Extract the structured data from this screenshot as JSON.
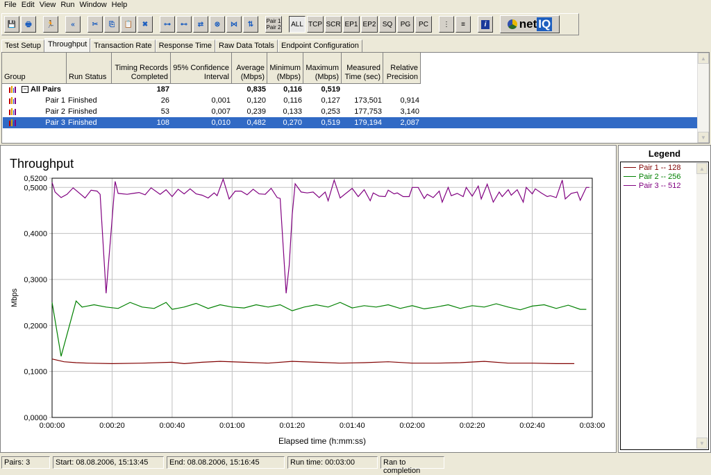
{
  "menu": [
    "File",
    "Edit",
    "View",
    "Run",
    "Window",
    "Help"
  ],
  "toolbar": {
    "buttons": [
      {
        "name": "save-icon",
        "label": "💾"
      },
      {
        "name": "print-icon",
        "label": "🖶"
      },
      {
        "name": "run-icon",
        "label": "🏃"
      },
      {
        "name": "stop-icon",
        "label": "«"
      },
      {
        "name": "cut-icon",
        "label": "✂"
      },
      {
        "name": "copy-icon",
        "label": "⎘"
      },
      {
        "name": "paste-icon",
        "label": "📋"
      },
      {
        "name": "delete-icon",
        "label": "✖"
      },
      {
        "name": "add-pair-icon",
        "label": "⊶"
      },
      {
        "name": "add-multicast-icon",
        "label": "⊷"
      },
      {
        "name": "edit-pair-icon",
        "label": "⇄"
      },
      {
        "name": "delete-pair-icon",
        "label": "⊗"
      },
      {
        "name": "network-icon",
        "label": "⋈"
      },
      {
        "name": "swap-icon",
        "label": "⇅"
      }
    ],
    "pair_toggle": [
      "Pair 1",
      "Pair 2"
    ],
    "filters": [
      "ALL",
      "TCP",
      "SCR",
      "EP1",
      "EP2",
      "SQ",
      "PG",
      "PC"
    ],
    "active_filter": "ALL",
    "logo": "netIQ"
  },
  "tabs": [
    "Test Setup",
    "Throughput",
    "Transaction Rate",
    "Response Time",
    "Raw Data Totals",
    "Endpoint Configuration"
  ],
  "active_tab": "Throughput",
  "table": {
    "columns": [
      [
        "Group",
        ""
      ],
      [
        "Run Status",
        ""
      ],
      [
        "Timing Records",
        "Completed"
      ],
      [
        "95% Confidence",
        "Interval"
      ],
      [
        "Average",
        "(Mbps)"
      ],
      [
        "Minimum",
        "(Mbps)"
      ],
      [
        "Maximum",
        "(Mbps)"
      ],
      [
        "Measured",
        "Time (sec)"
      ],
      [
        "Relative",
        "Precision"
      ]
    ],
    "group_row": {
      "label": "All Pairs",
      "records": "187",
      "average": "0,835",
      "minimum": "0,116",
      "maximum": "0,519"
    },
    "rows": [
      {
        "group": "Pair 1",
        "status": "Finished",
        "records": "26",
        "ci": "0,001",
        "average": "0,120",
        "minimum": "0,116",
        "maximum": "0,127",
        "time": "173,501",
        "precision": "0,914"
      },
      {
        "group": "Pair 2",
        "status": "Finished",
        "records": "53",
        "ci": "0,007",
        "average": "0,239",
        "minimum": "0,133",
        "maximum": "0,253",
        "time": "177,753",
        "precision": "3,140"
      },
      {
        "group": "Pair 3",
        "status": "Finished",
        "records": "108",
        "ci": "0,010",
        "average": "0,482",
        "minimum": "0,270",
        "maximum": "0,519",
        "time": "179,194",
        "precision": "2,087"
      }
    ],
    "selected_row": 2
  },
  "chart_data": {
    "type": "line",
    "title": "Throughput",
    "xlabel": "Elapsed time (h:mm:ss)",
    "ylabel": "Mbps",
    "xlim": [
      "0:00:00",
      "0:03:00"
    ],
    "ylim": [
      0,
      0.52
    ],
    "x_ticks": [
      "0:00:00",
      "0:00:20",
      "0:00:40",
      "0:01:00",
      "0:01:20",
      "0:01:40",
      "0:02:00",
      "0:02:20",
      "0:02:40",
      "0:03:00"
    ],
    "y_ticks": [
      "0,0000",
      "0,1000",
      "0,2000",
      "0,3000",
      "0,4000",
      "0,5000",
      "0,5200"
    ],
    "y_tick_values": [
      0,
      0.1,
      0.2,
      0.3,
      0.4,
      0.5,
      0.52
    ],
    "grid": true,
    "legend_placement": "right panel",
    "series": [
      {
        "name": "Pair 1 -- 128",
        "color": "#800000",
        "points": [
          [
            "0:00:00",
            0.127
          ],
          [
            "0:00:04",
            0.121
          ],
          [
            "0:00:08",
            0.119
          ],
          [
            "0:00:12",
            0.118
          ],
          [
            "0:00:20",
            0.117
          ],
          [
            "0:00:30",
            0.118
          ],
          [
            "0:00:40",
            0.12
          ],
          [
            "0:00:44",
            0.117
          ],
          [
            "0:00:50",
            0.12
          ],
          [
            "0:00:56",
            0.122
          ],
          [
            "0:01:04",
            0.12
          ],
          [
            "0:01:12",
            0.118
          ],
          [
            "0:01:20",
            0.122
          ],
          [
            "0:01:28",
            0.12
          ],
          [
            "0:01:36",
            0.118
          ],
          [
            "0:01:44",
            0.119
          ],
          [
            "0:01:52",
            0.121
          ],
          [
            "0:02:00",
            0.118
          ],
          [
            "0:02:08",
            0.118
          ],
          [
            "0:02:16",
            0.119
          ],
          [
            "0:02:24",
            0.122
          ],
          [
            "0:02:32",
            0.118
          ],
          [
            "0:02:40",
            0.118
          ],
          [
            "0:02:48",
            0.117
          ],
          [
            "0:02:54",
            0.117
          ]
        ]
      },
      {
        "name": "Pair 2 -- 256",
        "color": "#008000",
        "points": [
          [
            "0:00:00",
            0.25
          ],
          [
            "0:00:03",
            0.133
          ],
          [
            "0:00:08",
            0.253
          ],
          [
            "0:00:10",
            0.24
          ],
          [
            "0:00:14",
            0.245
          ],
          [
            "0:00:18",
            0.24
          ],
          [
            "0:00:22",
            0.237
          ],
          [
            "0:00:26",
            0.25
          ],
          [
            "0:00:30",
            0.24
          ],
          [
            "0:00:34",
            0.237
          ],
          [
            "0:00:38",
            0.25
          ],
          [
            "0:00:40",
            0.235
          ],
          [
            "0:00:44",
            0.24
          ],
          [
            "0:00:48",
            0.248
          ],
          [
            "0:00:52",
            0.237
          ],
          [
            "0:00:56",
            0.245
          ],
          [
            "0:01:00",
            0.24
          ],
          [
            "0:01:04",
            0.238
          ],
          [
            "0:01:08",
            0.245
          ],
          [
            "0:01:12",
            0.24
          ],
          [
            "0:01:16",
            0.245
          ],
          [
            "0:01:20",
            0.232
          ],
          [
            "0:01:24",
            0.24
          ],
          [
            "0:01:28",
            0.245
          ],
          [
            "0:01:32",
            0.24
          ],
          [
            "0:01:36",
            0.25
          ],
          [
            "0:01:40",
            0.238
          ],
          [
            "0:01:44",
            0.243
          ],
          [
            "0:01:48",
            0.24
          ],
          [
            "0:01:52",
            0.245
          ],
          [
            "0:01:56",
            0.237
          ],
          [
            "0:02:00",
            0.243
          ],
          [
            "0:02:04",
            0.236
          ],
          [
            "0:02:08",
            0.24
          ],
          [
            "0:02:12",
            0.245
          ],
          [
            "0:02:16",
            0.237
          ],
          [
            "0:02:20",
            0.243
          ],
          [
            "0:02:24",
            0.24
          ],
          [
            "0:02:28",
            0.247
          ],
          [
            "0:02:32",
            0.24
          ],
          [
            "0:02:36",
            0.234
          ],
          [
            "0:02:40",
            0.242
          ],
          [
            "0:02:44",
            0.245
          ],
          [
            "0:02:48",
            0.237
          ],
          [
            "0:02:52",
            0.244
          ],
          [
            "0:02:56",
            0.235
          ],
          [
            "0:02:58",
            0.235
          ]
        ]
      },
      {
        "name": "Pair 3 -- 512",
        "color": "#800080",
        "points": [
          [
            "0:00:00",
            0.511
          ],
          [
            "0:00:01",
            0.49
          ],
          [
            "0:00:03",
            0.478
          ],
          [
            "0:00:05",
            0.485
          ],
          [
            "0:00:07",
            0.499
          ],
          [
            "0:00:09",
            0.488
          ],
          [
            "0:00:11",
            0.477
          ],
          [
            "0:00:13",
            0.494
          ],
          [
            "0:00:15",
            0.492
          ],
          [
            "0:00:16",
            0.485
          ],
          [
            "0:00:18",
            0.27
          ],
          [
            "0:00:19",
            0.35
          ],
          [
            "0:00:20",
            0.43
          ],
          [
            "0:00:21",
            0.513
          ],
          [
            "0:00:22",
            0.487
          ],
          [
            "0:00:25",
            0.485
          ],
          [
            "0:00:27",
            0.487
          ],
          [
            "0:00:29",
            0.489
          ],
          [
            "0:00:31",
            0.484
          ],
          [
            "0:00:33",
            0.499
          ],
          [
            "0:00:36",
            0.485
          ],
          [
            "0:00:38",
            0.495
          ],
          [
            "0:00:40",
            0.48
          ],
          [
            "0:00:42",
            0.496
          ],
          [
            "0:00:44",
            0.486
          ],
          [
            "0:00:46",
            0.497
          ],
          [
            "0:00:48",
            0.486
          ],
          [
            "0:00:50",
            0.483
          ],
          [
            "0:00:52",
            0.477
          ],
          [
            "0:00:54",
            0.488
          ],
          [
            "0:00:55",
            0.482
          ],
          [
            "0:00:57",
            0.518
          ],
          [
            "0:00:59",
            0.475
          ],
          [
            "0:01:01",
            0.492
          ],
          [
            "0:01:03",
            0.492
          ],
          [
            "0:01:05",
            0.484
          ],
          [
            "0:01:07",
            0.496
          ],
          [
            "0:01:09",
            0.486
          ],
          [
            "0:01:11",
            0.485
          ],
          [
            "0:01:13",
            0.498
          ],
          [
            "0:01:15",
            0.478
          ],
          [
            "0:01:16",
            0.476
          ],
          [
            "0:01:18",
            0.27
          ],
          [
            "0:01:19",
            0.33
          ],
          [
            "0:01:20",
            0.44
          ],
          [
            "0:01:21",
            0.508
          ],
          [
            "0:01:23",
            0.49
          ],
          [
            "0:01:25",
            0.488
          ],
          [
            "0:01:27",
            0.49
          ],
          [
            "0:01:29",
            0.478
          ],
          [
            "0:01:31",
            0.49
          ],
          [
            "0:01:32",
            0.471
          ],
          [
            "0:01:34",
            0.516
          ],
          [
            "0:01:36",
            0.477
          ],
          [
            "0:01:40",
            0.498
          ],
          [
            "0:01:42",
            0.48
          ],
          [
            "0:01:44",
            0.495
          ],
          [
            "0:01:46",
            0.471
          ],
          [
            "0:01:47",
            0.488
          ],
          [
            "0:01:49",
            0.481
          ],
          [
            "0:01:51",
            0.48
          ],
          [
            "0:01:52",
            0.494
          ],
          [
            "0:01:54",
            0.486
          ],
          [
            "0:01:55",
            0.488
          ],
          [
            "0:01:57",
            0.48
          ],
          [
            "0:01:59",
            0.48
          ],
          [
            "0:02:00",
            0.5
          ],
          [
            "0:02:02",
            0.5
          ],
          [
            "0:02:04",
            0.476
          ],
          [
            "0:02:05",
            0.485
          ],
          [
            "0:02:07",
            0.478
          ],
          [
            "0:02:09",
            0.492
          ],
          [
            "0:02:10",
            0.468
          ],
          [
            "0:02:12",
            0.5
          ],
          [
            "0:02:13",
            0.482
          ],
          [
            "0:02:15",
            0.487
          ],
          [
            "0:02:17",
            0.48
          ],
          [
            "0:02:18",
            0.5
          ],
          [
            "0:02:20",
            0.481
          ],
          [
            "0:02:22",
            0.503
          ],
          [
            "0:02:23",
            0.475
          ],
          [
            "0:02:25",
            0.507
          ],
          [
            "0:02:27",
            0.468
          ],
          [
            "0:02:29",
            0.49
          ],
          [
            "0:02:30",
            0.48
          ],
          [
            "0:02:32",
            0.495
          ],
          [
            "0:02:33",
            0.483
          ],
          [
            "0:02:35",
            0.495
          ],
          [
            "0:02:37",
            0.468
          ],
          [
            "0:02:38",
            0.5
          ],
          [
            "0:02:40",
            0.486
          ],
          [
            "0:02:41",
            0.497
          ],
          [
            "0:02:43",
            0.488
          ],
          [
            "0:02:45",
            0.48
          ],
          [
            "0:02:46",
            0.482
          ],
          [
            "0:02:48",
            0.478
          ],
          [
            "0:02:50",
            0.516
          ],
          [
            "0:02:51",
            0.475
          ],
          [
            "0:02:53",
            0.487
          ],
          [
            "0:02:55",
            0.49
          ],
          [
            "0:02:56",
            0.472
          ],
          [
            "0:02:58",
            0.5
          ],
          [
            "0:02:59",
            0.5
          ]
        ]
      }
    ]
  },
  "legend": {
    "title": "Legend"
  },
  "status": [
    "Pairs: 3",
    "Start: 08.08.2006, 15:13:45",
    "End: 08.08.2006, 15:16:45",
    "Run time: 00:03:00",
    "Ran to completion"
  ]
}
